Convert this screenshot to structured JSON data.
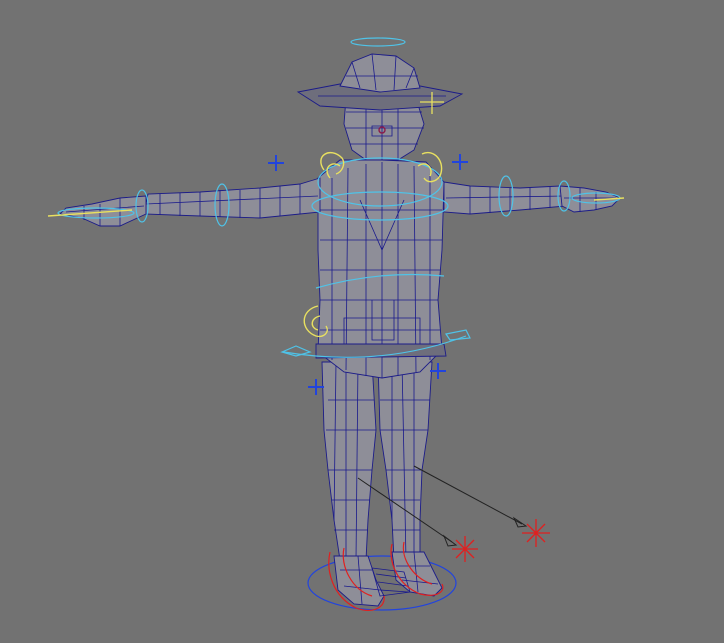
{
  "viewport": {
    "background_color": "#727272",
    "mesh_fill_color": "#8e8e98",
    "wireframe_color": "#1c1c88",
    "control_ring_color": "#4fc3e8",
    "selected_control_color": "#e8e060",
    "foot_control_color": "#e02020",
    "locator_color": "#2244dd"
  },
  "scene": {
    "object_icon": "character-rig-icon",
    "pose": "T-pose"
  }
}
